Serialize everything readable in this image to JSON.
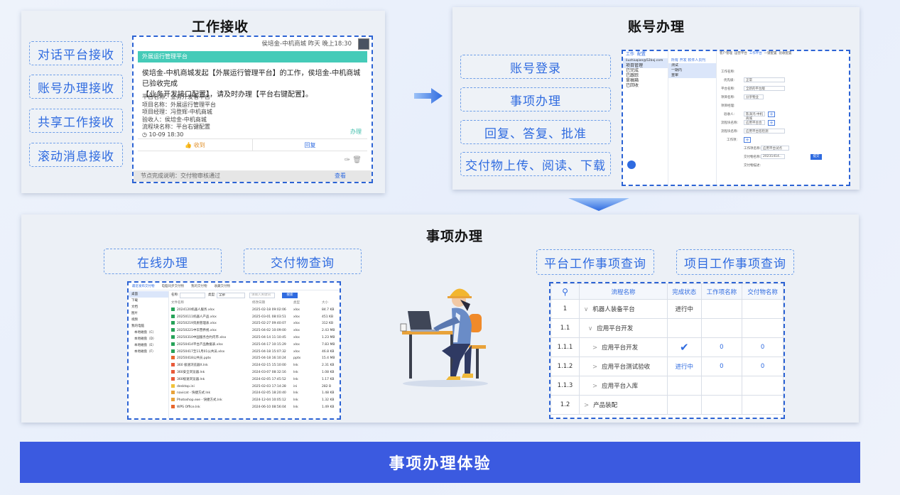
{
  "work_receive": {
    "title": "工作接收",
    "buttons": [
      "对话平台接收",
      "账号办理接收",
      "共享工作接收",
      "滚动消息接收"
    ],
    "card": {
      "meta": "侯培金-中机商城   昨天 晚上18:30",
      "header": "外展运行管理平台",
      "message_line1": "侯培金-中机商城发起【外展运行管理平台】的工作，侯培金-中机商城已验收完成",
      "message_line2": "【业务开发接口配置】，请及时办理【平台右键配置】。",
      "info": [
        "平台名称：业务开发者平台",
        "项目名称：外展运行管理平台",
        "项目经理：冯登辉-中机商城",
        "验收人：侯培金-中机商城",
        "流程块名称：平台右键配置"
      ],
      "time": "◷ 10-09 18:30",
      "done": "办理",
      "action_receive": "👍 收到",
      "action_reply": "回复",
      "tools": "✑ 🗑",
      "footer": "节点完成说明：交付物审核通过",
      "footer_link": "查看"
    }
  },
  "account": {
    "title": "账号办理",
    "buttons": [
      "账号登录",
      "事项办理",
      "回复、答复、批准",
      "交付物上传、阅读、下载"
    ],
    "mini": {
      "tabs": [
        "工作",
        "配置"
      ],
      "email": "liuzhiuqian@52bxj.com",
      "left_items": [
        "项目管理",
        "已完成",
        "已跟踪",
        "草稿箱",
        "已回收"
      ],
      "mid_tabs": [
        "所有",
        "开发",
        "软件人员刊"
      ],
      "mid_items": [
        "测试",
        "一期内",
        "重审"
      ],
      "right_tabs": [
        "客户管理",
        "运营平台",
        "工作平台",
        "一键配置",
        "验收配置"
      ],
      "fields": [
        "工作名称:",
        "优先级:",
        "平台名称:",
        "项目名称:",
        "项目经理:",
        "验收人:",
        "流程块名称:",
        "流程块名称:",
        "工作项:",
        "工作项名称:",
        "交付物名称:",
        "交付物描述:"
      ],
      "values": [
        "正常",
        "全新的平台版",
        "分享物业",
        "陈泽鸿-中机商城",
        "应用平台合",
        "应用平台巡检测",
        "应用平台试点",
        "20231414.."
      ],
      "submit": "提交"
    }
  },
  "matters": {
    "title": "事项办理",
    "left_buttons": [
      "在线办理",
      "交付物查询"
    ],
    "right_buttons": [
      "平台工作事项查询",
      "项目工作事项查询"
    ],
    "files": {
      "tabs": [
        "最近发布交付物",
        "电脑同步交付物",
        "我的交付物",
        "收藏交付物"
      ],
      "side": [
        "桌面",
        "下载",
        "文档",
        "图片",
        "视频",
        "我的电脑",
        "本地磁盘（C）",
        "本地磁盘（D）",
        "本地磁盘（E）",
        "本地磁盘（F）"
      ],
      "search_label": "名称:",
      "type_label": "类型:",
      "type_value": "全部",
      "search_hint": "请输入关键词",
      "search_btn": "搜索",
      "headers": [
        "文件名称",
        "修改日期",
        "类型",
        "大小"
      ],
      "rows": [
        [
          "2024120机器人服务.xlsx",
          "2025-02-18 09:02:06",
          "xlsx",
          "84.7 KB"
        ],
        [
          "20250111机器人产品.xlsx",
          "2025-03-01 08:03:51",
          "xlsx",
          "451 KB"
        ],
        [
          "20250219资质管理表.xlsx",
          "2025-02-27 09:40:07",
          "xlsx",
          "312 KB"
        ],
        [
          "20250221中华营养视.xlsx",
          "2025-04-02 10:09:00",
          "xlsx",
          "2.43 MB"
        ],
        [
          "20250310中国服务合约内市.xlsx",
          "2025-04-14 11:10:45",
          "xlsx",
          "1.23 MB"
        ],
        [
          "20250414平台产品数据表.xlsx",
          "2025-04-17 10:15:29",
          "xlsx",
          "7.83 MB"
        ],
        [
          "20250417至11月01公共员.xlsx",
          "2025-04-18 15:07:32",
          "xlsx",
          "46.8 KB"
        ],
        [
          "20250418公共员.pptx",
          "2025-04-18 16:10:24",
          "pptx",
          "15.4 MB"
        ],
        [
          "360 极速浏览器X.lnk",
          "2024-02-15 15:10:00",
          "lnk",
          "2.31 KB"
        ],
        [
          "360安全浏览器.lnk",
          "2024-03-07 08:32:16",
          "lnk",
          "1.08 KB"
        ],
        [
          "360极速浏览器.lnk",
          "2024-02-05 17:45:52",
          "lnk",
          "1.17 KB"
        ],
        [
          "desktop.ini",
          "2025-02-03 17:14:28",
          "ini",
          "282 B"
        ],
        [
          "navicat - 快捷方式.lnk",
          "2024-02-05 18:20:40",
          "lnk",
          "1.48 KB"
        ],
        [
          "Photoshop.exe - 快捷方式.lnk",
          "2024-12-04 10:05:12",
          "lnk",
          "1.32 KB"
        ],
        [
          "WPS Office.lnk",
          "2024-06-10 08:56:04",
          "lnk",
          "1.49 KB"
        ]
      ]
    },
    "table": {
      "headers": [
        "流程名称",
        "完成状态",
        "工作项名称",
        "交付物名称"
      ],
      "rows": [
        {
          "no": "1",
          "toggle": "∨",
          "name": "机器人装备平台",
          "status": "进行中",
          "work": "",
          "deliver": ""
        },
        {
          "no": "1.1",
          "toggle": "∨",
          "name": "应用平台开发",
          "status": "",
          "work": "",
          "deliver": ""
        },
        {
          "no": "1.1.1",
          "toggle": ">",
          "name": "应用平台开发",
          "status": "✔",
          "work": "0",
          "deliver": "0"
        },
        {
          "no": "1.1.2",
          "toggle": ">",
          "name": "应用平台测试验收",
          "status": "进行中",
          "work": "0",
          "deliver": "0"
        },
        {
          "no": "1.1.3",
          "toggle": ">",
          "name": "应用平台入库",
          "status": "",
          "work": "",
          "deliver": ""
        },
        {
          "no": "1.2",
          "toggle": ">",
          "name": "产品装配",
          "status": "",
          "work": "",
          "deliver": ""
        }
      ]
    }
  },
  "bottom": "事项办理体验",
  "colors": {
    "accent": "#2f6be0",
    "bar": "#3b5ae0",
    "teal": "#45cbb8"
  }
}
